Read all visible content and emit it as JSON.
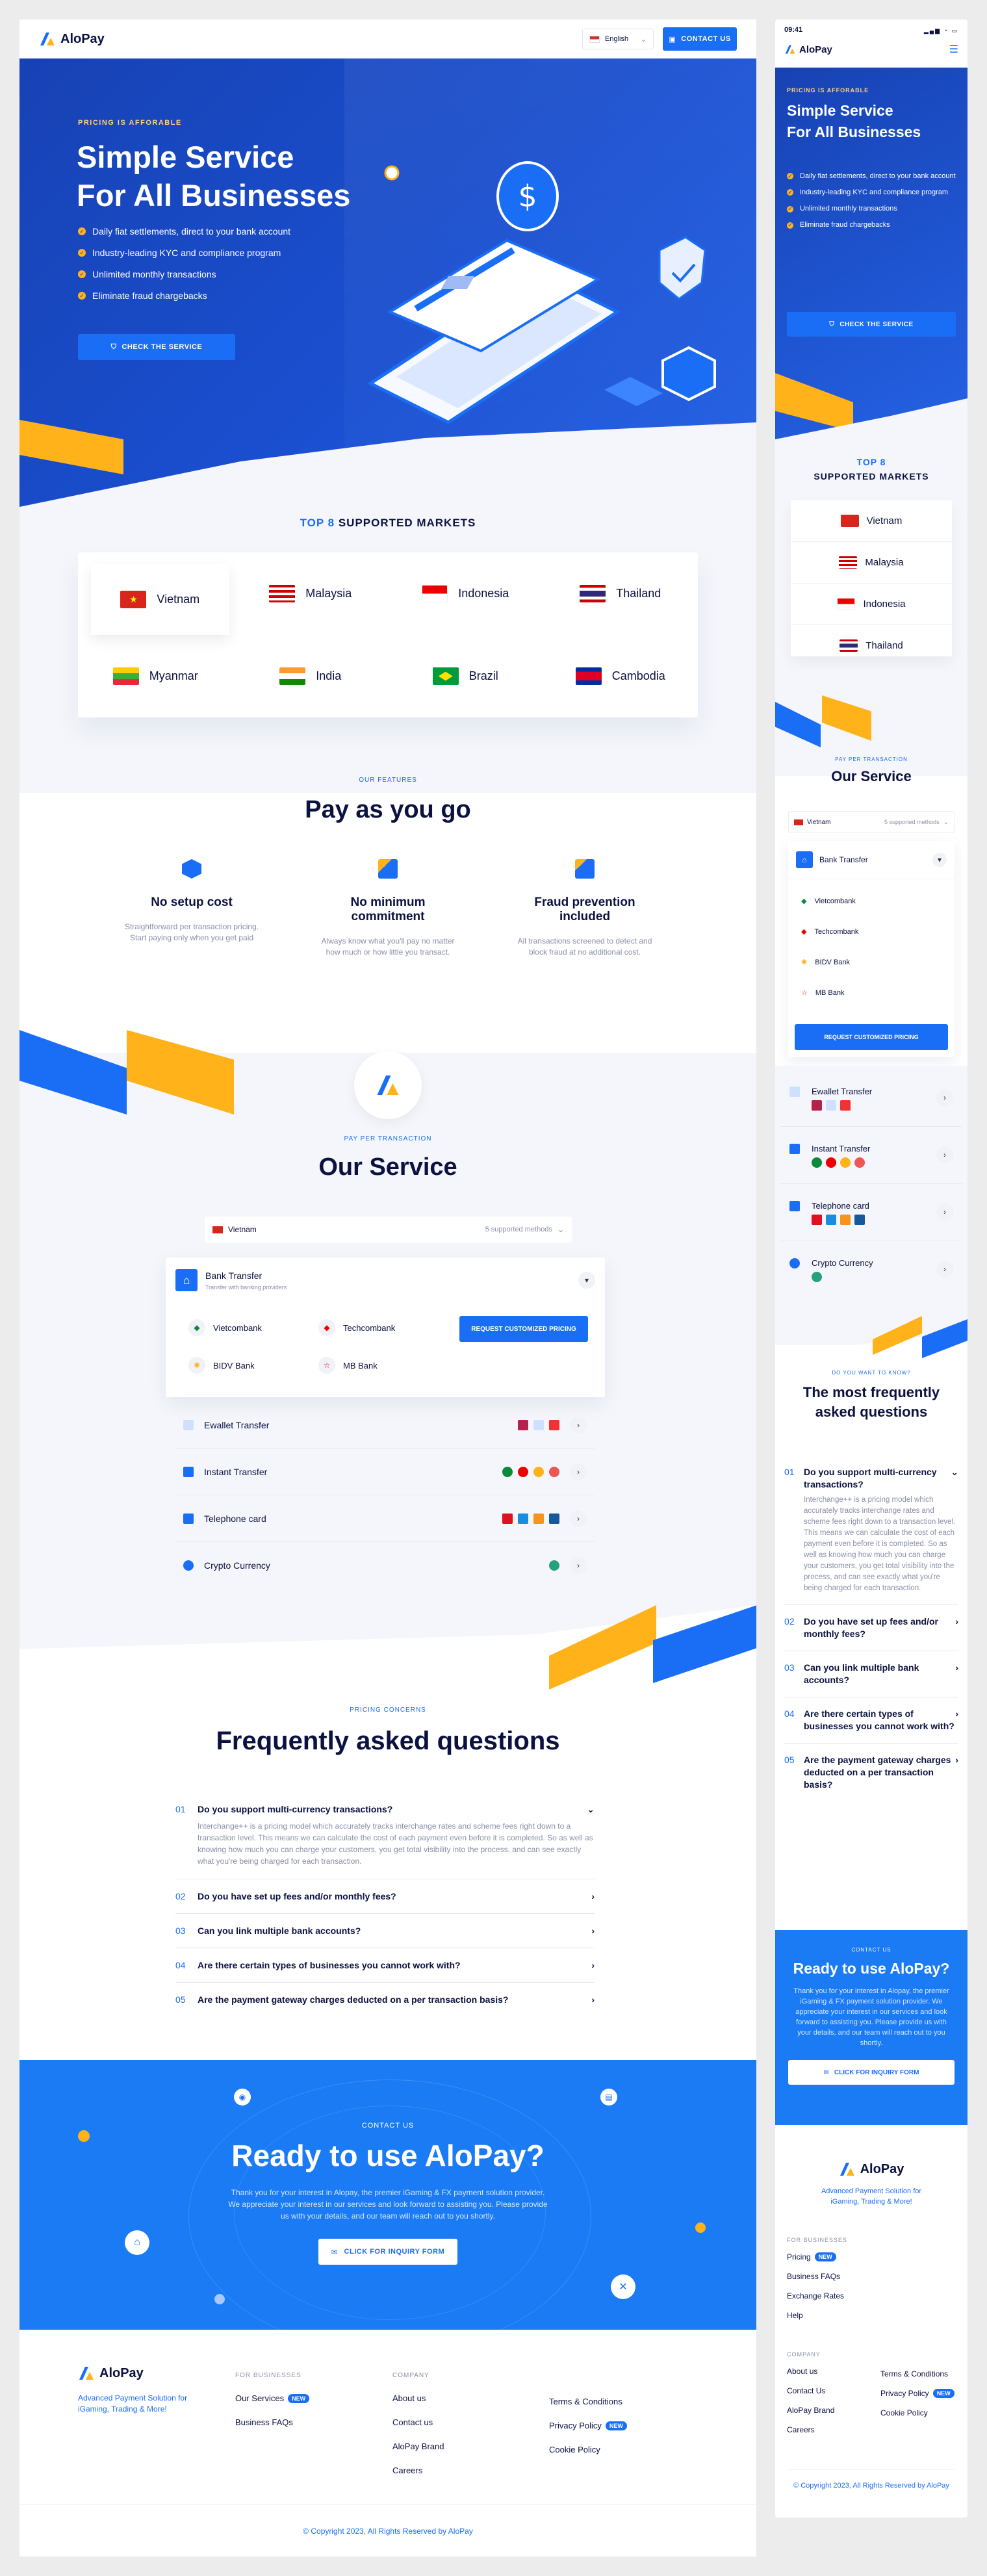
{
  "brand": {
    "name": "AloPay",
    "tagline": "Advanced Payment Solution for iGaming, Trading & More!",
    "colors": {
      "primary": "#1a6ef5",
      "accent": "#ffb21a",
      "dark": "#0b1240"
    }
  },
  "nav": {
    "language": "English",
    "contact_label": "CONTACT US"
  },
  "hero": {
    "eyebrow": "PRICING IS AFFORABLE",
    "title_line1": "Simple Service",
    "title_line2": "For All Businesses",
    "bullets": [
      "Daily fiat settlements, direct to your bank account",
      "Industry-leading KYC and compliance program",
      "Unlimited monthly transactions",
      "Eliminate fraud chargebacks"
    ],
    "cta": "CHECK THE SERVICE"
  },
  "markets": {
    "title_accent": "TOP 8",
    "title_rest": "SUPPORTED MARKETS",
    "mobile_line1": "TOP 8",
    "mobile_line2": "SUPPORTED MARKETS",
    "items": [
      "Vietnam",
      "Malaysia",
      "Indonesia",
      "Thailand",
      "Myanmar",
      "India",
      "Brazil",
      "Cambodia"
    ]
  },
  "features": {
    "eyebrow": "OUR FEATURES",
    "title": "Pay as you go",
    "items": [
      {
        "title": "No setup cost",
        "text": "Straightforward per transaction pricing. Start paying only when you get paid"
      },
      {
        "title": "No minimum commitment",
        "text": "Always know what you'll pay no matter how much or how little you transact."
      },
      {
        "title": "Fraud prevention included",
        "text": "All transactions screened to detect and block fraud at no additional cost."
      }
    ]
  },
  "service": {
    "eyebrow": "PAY PER TRANSACTION",
    "title": "Our Service",
    "country": "Vietnam",
    "methods_count": "5 supported methods",
    "bank_title": "Bank Transfer",
    "bank_sub": "Transfer with banking providers",
    "banks": [
      "Vietcombank",
      "Techcombank",
      "BIDV Bank",
      "MB Bank"
    ],
    "request_btn": "REQUEST CUSTOMIZED PRICING",
    "rows": [
      "Ewallet Transfer",
      "Instant Transfer",
      "Telephone card",
      "Crypto Currency"
    ]
  },
  "faq": {
    "eyebrow": "PRICING CONCERNS",
    "title": "Frequently asked questions",
    "mobile_eyebrow": "DO YOU WANT TO KNOW?",
    "mobile_title": "The most frequently asked questions",
    "items": [
      {
        "num": "01",
        "q": "Do you support multi-currency transactions?",
        "a": "Interchange++ is a pricing model which accurately tracks interchange rates and scheme fees right down to a transaction level. This means we can calculate the cost of each payment even before it is completed. So as well as knowing how much you can charge your customers, you get total visibility into the process, and can see exactly what you're being charged for each transaction."
      },
      {
        "num": "02",
        "q": "Do you have set up fees and/or monthly fees?"
      },
      {
        "num": "03",
        "q": "Can you link multiple bank accounts?"
      },
      {
        "num": "04",
        "q": "Are there certain types of businesses you cannot work with?"
      },
      {
        "num": "05",
        "q": "Are the payment gateway charges deducted on a per transaction basis?"
      }
    ]
  },
  "contact": {
    "eyebrow": "CONTACT US",
    "title": "Ready to use AloPay?",
    "text": "Thank you for your interest in Alopay, the premier iGaming & FX payment solution provider. We appreciate your interest in our services and look forward to assisting you. Please provide us with your details, and our team will reach out to you shortly.",
    "cta": "CLICK FOR INQUIRY FORM"
  },
  "footer": {
    "col1_head": "FOR BUSINESSES",
    "col1": [
      "Our Services",
      "Business FAQs"
    ],
    "col2_head": "COMPANY",
    "col2": [
      "About us",
      "Contact us",
      "AloPay Brand",
      "Careers"
    ],
    "col3": [
      "Terms & Conditions",
      "Privacy Policy",
      "Cookie Policy"
    ],
    "new_badge": "NEW",
    "copyright": "© Copyright 2023, All Rights Reserved by AloPay",
    "mobile_biz": [
      "Pricing",
      "Business FAQs",
      "Exchange Rates",
      "Help"
    ],
    "mobile_company_left": [
      "About us",
      "Contact Us",
      "AloPay Brand",
      "Careers"
    ],
    "mobile_company_right": [
      "Terms & Conditions",
      "Privacy Policy",
      "Cookie Policy"
    ]
  },
  "mobile": {
    "time": "09:41"
  }
}
